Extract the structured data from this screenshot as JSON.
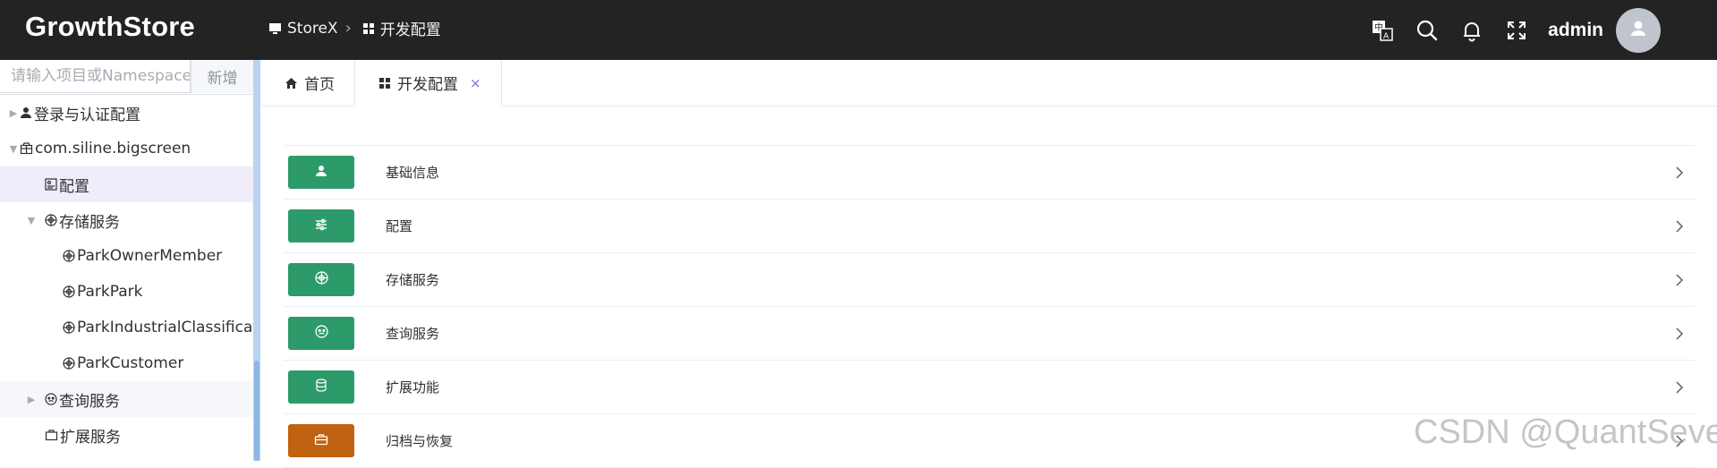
{
  "app": {
    "brand": "GrowthStore"
  },
  "breadcrumb": [
    {
      "label": "StoreX",
      "icon": "monitor-icon"
    },
    {
      "label": "开发配置",
      "icon": "grid-icon"
    }
  ],
  "header": {
    "user": "admin"
  },
  "sidebar": {
    "search_placeholder": "请输入项目或Namespace",
    "add_label": "新增",
    "nodes": [
      {
        "label": "登录与认证配置",
        "icon": "user-icon"
      },
      {
        "label": "com.siline.bigscreen",
        "icon": "package-icon"
      },
      {
        "label": "配置",
        "icon": "config-icon"
      },
      {
        "label": "存储服务",
        "icon": "storage-icon"
      },
      {
        "label": "ParkOwnerMember",
        "icon": "storage-icon"
      },
      {
        "label": "ParkPark",
        "icon": "storage-icon"
      },
      {
        "label": "ParkIndustrialClassification",
        "icon": "storage-icon"
      },
      {
        "label": "ParkCustomer",
        "icon": "storage-icon"
      },
      {
        "label": "查询服务",
        "icon": "query-icon"
      },
      {
        "label": "扩展服务",
        "icon": "extension-icon"
      }
    ]
  },
  "tabs": [
    {
      "label": "首页",
      "icon": "home-icon"
    },
    {
      "label": "开发配置",
      "icon": "grid-icon",
      "close": "×"
    }
  ],
  "menu": [
    {
      "label": "基础信息",
      "icon": "user-icon",
      "color": "#2d9a6a"
    },
    {
      "label": "配置",
      "icon": "sliders-icon",
      "color": "#2d9a6a"
    },
    {
      "label": "存储服务",
      "icon": "storage-icon",
      "color": "#2d9a6a"
    },
    {
      "label": "查询服务",
      "icon": "query-icon",
      "color": "#2d9a6a"
    },
    {
      "label": "扩展功能",
      "icon": "database-icon",
      "color": "#2d9a6a"
    },
    {
      "label": "归档与恢复",
      "icon": "briefcase-icon",
      "color": "#c0620f"
    }
  ],
  "watermark": "CSDN @QuantSeven",
  "colors": {
    "header_bg": "#232323",
    "accent_green": "#2d9a6a",
    "accent_orange": "#c0620f",
    "selected_bg": "#f0ecfa"
  }
}
